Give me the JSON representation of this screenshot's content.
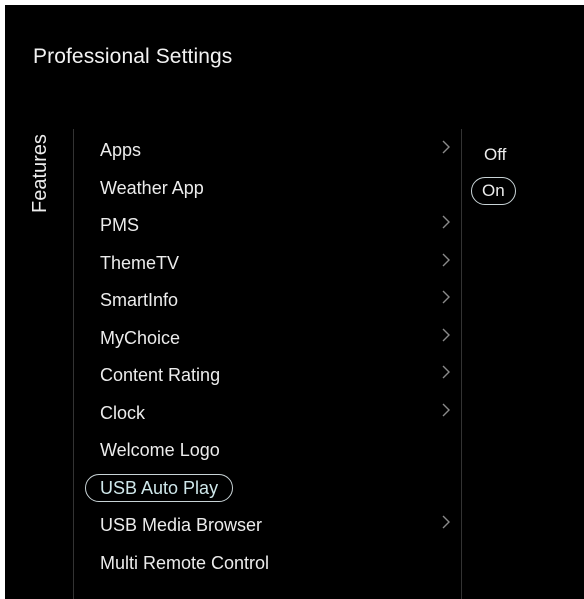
{
  "header": {
    "title": "Professional Settings"
  },
  "section": {
    "label": "Features"
  },
  "menu": {
    "items": [
      {
        "label": "Apps",
        "has_submenu": true,
        "selected": false
      },
      {
        "label": "Weather App",
        "has_submenu": false,
        "selected": false
      },
      {
        "label": "PMS",
        "has_submenu": true,
        "selected": false
      },
      {
        "label": "ThemeTV",
        "has_submenu": true,
        "selected": false
      },
      {
        "label": "SmartInfo",
        "has_submenu": true,
        "selected": false
      },
      {
        "label": "MyChoice",
        "has_submenu": true,
        "selected": false
      },
      {
        "label": "Content Rating",
        "has_submenu": true,
        "selected": false
      },
      {
        "label": "Clock",
        "has_submenu": true,
        "selected": false
      },
      {
        "label": "Welcome Logo",
        "has_submenu": false,
        "selected": false
      },
      {
        "label": "USB Auto Play",
        "has_submenu": false,
        "selected": true
      },
      {
        "label": "USB Media Browser",
        "has_submenu": true,
        "selected": false
      },
      {
        "label": "Multi Remote Control",
        "has_submenu": false,
        "selected": false
      }
    ]
  },
  "options": {
    "items": [
      {
        "label": "Off",
        "selected": false
      },
      {
        "label": "On",
        "selected": true
      }
    ]
  },
  "colors": {
    "background": "#000000",
    "text": "#ececec",
    "highlight_border": "#c8d3d6",
    "chevron": "#8a8a8a",
    "divider": "#333333"
  }
}
